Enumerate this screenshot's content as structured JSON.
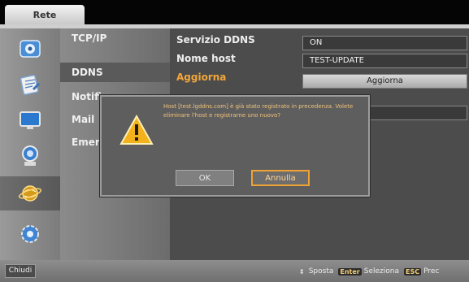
{
  "header": {
    "tab_label": "Rete"
  },
  "sidebar_icons": [
    {
      "icon": "settings-icon"
    },
    {
      "icon": "notes-icon"
    },
    {
      "icon": "display-icon"
    },
    {
      "icon": "camera-icon"
    },
    {
      "icon": "network-globe-icon"
    },
    {
      "icon": "gear-icon"
    }
  ],
  "menu": {
    "items": [
      {
        "label": "TCP/IP"
      },
      {
        "label": "DDNS"
      },
      {
        "label": "Notifica"
      },
      {
        "label": "Mail"
      },
      {
        "label": "Emer"
      }
    ],
    "selected": "DDNS"
  },
  "settings": {
    "rows": [
      {
        "label": "Servizio DDNS",
        "value": "ON"
      },
      {
        "label": "Nome host",
        "value": "TEST-UPDATE"
      },
      {
        "label": "Aggiorna",
        "value": "Aggiorna"
      }
    ]
  },
  "dialog": {
    "message": "Host [test.lgddns.com] è già stato registrato in precedenza. Volete eliminare l'host e registrarne uno nuovo?",
    "ok_label": "OK",
    "cancel_label": "Annulla",
    "icon": "warning-icon"
  },
  "footer": {
    "close_label": "Chiudi",
    "hints": [
      {
        "key": "⇕",
        "text": "Sposta"
      },
      {
        "key": "Enter",
        "text": "Seleziona"
      },
      {
        "key": "ESC",
        "text": "Prec"
      }
    ]
  },
  "colors": {
    "accent": "#f2a63a",
    "panel": "#4c4c4c",
    "dialog": "#5e5e5e"
  }
}
